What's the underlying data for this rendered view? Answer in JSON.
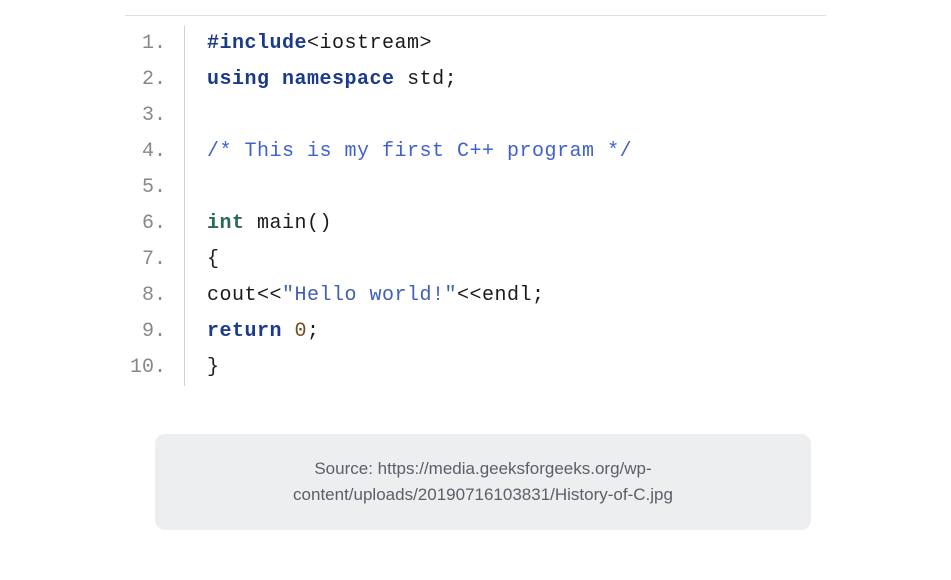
{
  "code": {
    "lines": [
      {
        "num": "1.",
        "segments": [
          {
            "cls": "include-kw",
            "text": "#include"
          },
          {
            "cls": "include-lib",
            "text": "<iostream>"
          }
        ]
      },
      {
        "num": "2.",
        "segments": [
          {
            "cls": "keyword",
            "text": "using"
          },
          {
            "cls": "",
            "text": " "
          },
          {
            "cls": "keyword",
            "text": "namespace"
          },
          {
            "cls": "",
            "text": " std;"
          }
        ]
      },
      {
        "num": "3.",
        "segments": [
          {
            "cls": "",
            "text": ""
          }
        ]
      },
      {
        "num": "4.",
        "segments": [
          {
            "cls": "comment",
            "text": "/* This is my first C++ program */"
          }
        ]
      },
      {
        "num": "5.",
        "segments": [
          {
            "cls": "",
            "text": ""
          }
        ]
      },
      {
        "num": "6.",
        "segments": [
          {
            "cls": "type",
            "text": "int"
          },
          {
            "cls": "",
            "text": " main()"
          }
        ]
      },
      {
        "num": "7.",
        "segments": [
          {
            "cls": "",
            "text": "{"
          }
        ]
      },
      {
        "num": "8.",
        "segments": [
          {
            "cls": "",
            "text": "cout<<"
          },
          {
            "cls": "string",
            "text": "\"Hello world!\""
          },
          {
            "cls": "",
            "text": "<<endl;"
          }
        ]
      },
      {
        "num": "9.",
        "segments": [
          {
            "cls": "keyword",
            "text": "return"
          },
          {
            "cls": "",
            "text": " "
          },
          {
            "cls": "number-lit",
            "text": "0"
          },
          {
            "cls": "",
            "text": ";"
          }
        ]
      },
      {
        "num": "10.",
        "segments": [
          {
            "cls": "",
            "text": "}"
          }
        ]
      }
    ]
  },
  "source": {
    "text": "Source: https://media.geeksforgeeks.org/wp-content/uploads/20190716103831/History-of-C.jpg"
  }
}
